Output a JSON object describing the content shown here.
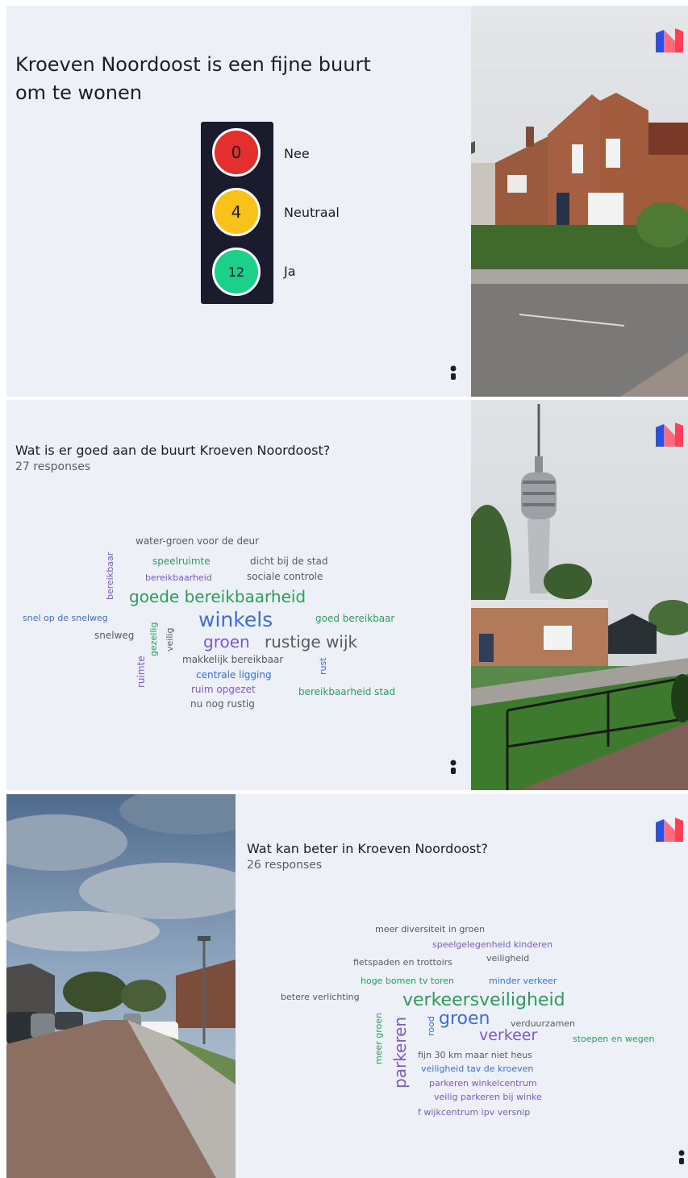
{
  "slides": {
    "one": {
      "title": "Kroeven Noordoost is een fijne buurt om te wonen",
      "traffic_light": {
        "nee_count": "0",
        "nee_label": "Nee",
        "neutraal_count": "4",
        "neutraal_label": "Neutraal",
        "ja_count": "12",
        "ja_label": "Ja"
      },
      "photo_icon": "brick-house-photo"
    },
    "two": {
      "question": "Wat is er goed aan de buurt Kroeven Noordoost?",
      "responses": "27 responses",
      "photo_icon": "tv-tower-photo",
      "words": {
        "w1": "water-groen voor de deur",
        "w2": "bereikbaar",
        "w3": "speelruimte",
        "w4": "dicht bij de stad",
        "w5": "bereikbaarheid",
        "w6": "sociale controle",
        "w7": "goede bereikbaarheid",
        "w8": "snel op de snelweg",
        "w9": "gezellig",
        "w10": "veilig",
        "w11": "winkels",
        "w12": "goed bereikbaar",
        "w13": "snelweg",
        "w14": "groen",
        "w15": "rustige wijk",
        "w16": "ruimte",
        "w17": "makkelijk bereikbaar",
        "w18": "rust",
        "w19": "centrale ligging",
        "w20": "ruim opgezet",
        "w21": "bereikbaarheid stad",
        "w22": "nu nog rustig"
      }
    },
    "three": {
      "question": "Wat kan beter in Kroeven Noordoost?",
      "responses": "26 responses",
      "photo_icon": "street-photo",
      "words": {
        "w1": "meer diversiteit in groen",
        "w2": "speelgelegenheid kinderen",
        "w3": "fietspaden en trottoirs",
        "w4": "veiligheid",
        "w5": "hoge bomen tv toren",
        "w6": "minder verkeer",
        "w7": "betere verlichting",
        "w8": "verkeersveiligheid",
        "w9": "meer groen",
        "w10": "rood",
        "w11": "groen",
        "w12": "verduurzamen",
        "w13": "parkeren",
        "w14": "verkeer",
        "w15": "stoepen en wegen",
        "w16": "fijn 30 km maar niet heus",
        "w17": "veiligheid tav de kroeven",
        "w18": "parkeren winkelcentrum",
        "w19": "veilig parkeren bij winke",
        "w20": "f wijkcentrum ipv versnip"
      }
    }
  },
  "icons": {
    "logo": "mentimeter-logo-icon",
    "presenter": "person-icon"
  },
  "colors": {
    "slide_bg": "#eef0f7",
    "dark_text": "#1c1c2a",
    "red": "#e3302c",
    "yellow": "#f9c21b",
    "green": "#1bd18a",
    "cloud_gray": "#5a5a5a",
    "cloud_green": "#2e9b59",
    "cloud_blue": "#3a6fd8",
    "cloud_purple": "#7b5ac8"
  }
}
